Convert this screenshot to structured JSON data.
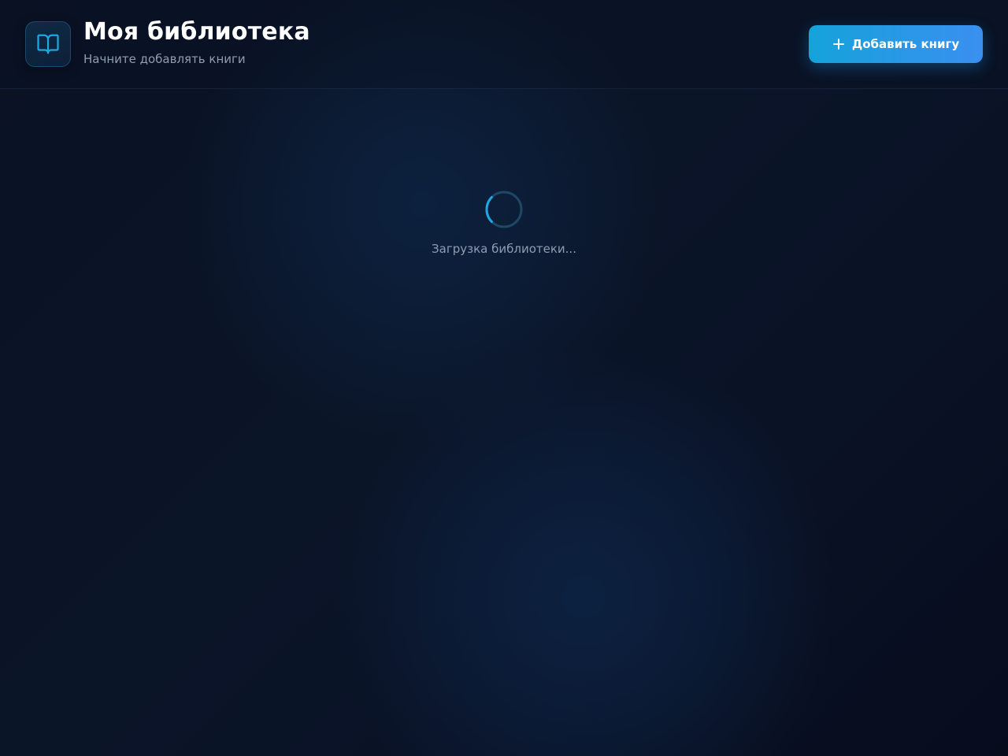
{
  "header": {
    "title": "Моя библиотека",
    "subtitle": "Начните добавлять книги",
    "logo_icon": "open-book-icon",
    "add_button": {
      "label": "Добавить книгу",
      "icon": "plus-icon"
    }
  },
  "main": {
    "loading_text": "Загрузка библиотеки...",
    "spinner_icon": "loading-spinner-icon"
  },
  "colors": {
    "accent": "#1ea7e0",
    "accent_gradient_end": "#3a8ff0",
    "background": "#0a1224",
    "muted_text": "#8f9db3"
  }
}
